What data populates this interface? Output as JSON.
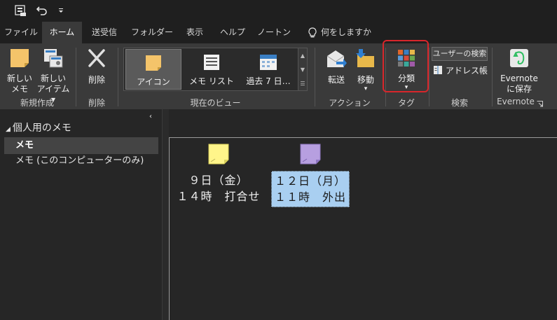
{
  "quick_access": {
    "icons": [
      "send-receive-icon",
      "undo-icon",
      "customize-dropdown-icon"
    ]
  },
  "tabs": [
    {
      "label": "ファイル"
    },
    {
      "label": "ホーム"
    },
    {
      "label": "送受信"
    },
    {
      "label": "フォルダー"
    },
    {
      "label": "表示"
    },
    {
      "label": "ヘルプ"
    },
    {
      "label": "ノートン"
    },
    {
      "label": "何をしますか"
    }
  ],
  "ribbon": {
    "new_note": {
      "line1": "新しい",
      "line2": "メモ"
    },
    "new_item": {
      "line1": "新しい",
      "line2": "アイテム ▾"
    },
    "group_new": "新規作成",
    "delete": "削除",
    "group_delete": "削除",
    "gallery": [
      "アイコン",
      "メモ リスト",
      "過去 7 日…"
    ],
    "group_view": "現在のビュー",
    "forward": "転送",
    "move": "移動",
    "group_actions": "アクション",
    "categorize": "分類",
    "group_tags": "タグ",
    "search_people": "ユーザーの検索",
    "address_book": "アドレス帳",
    "group_search": "検索",
    "evernote": {
      "line1": "Evernote",
      "line2": "に保存"
    },
    "group_evernote": "Evernote"
  },
  "nav": {
    "header": "個人用のメモ",
    "items": [
      "メモ",
      "メモ (このコンピューターのみ)"
    ]
  },
  "notes": [
    {
      "line1": "９日（金）",
      "line2": "１４時　打合せ",
      "color": "#fff58a"
    },
    {
      "line1": "１２日（月）",
      "line2": "１１時　外出",
      "color": "#b79fe0"
    }
  ],
  "colors": {
    "accent_highlight": "#d8262b",
    "selection_bg": "#a9cff1"
  }
}
